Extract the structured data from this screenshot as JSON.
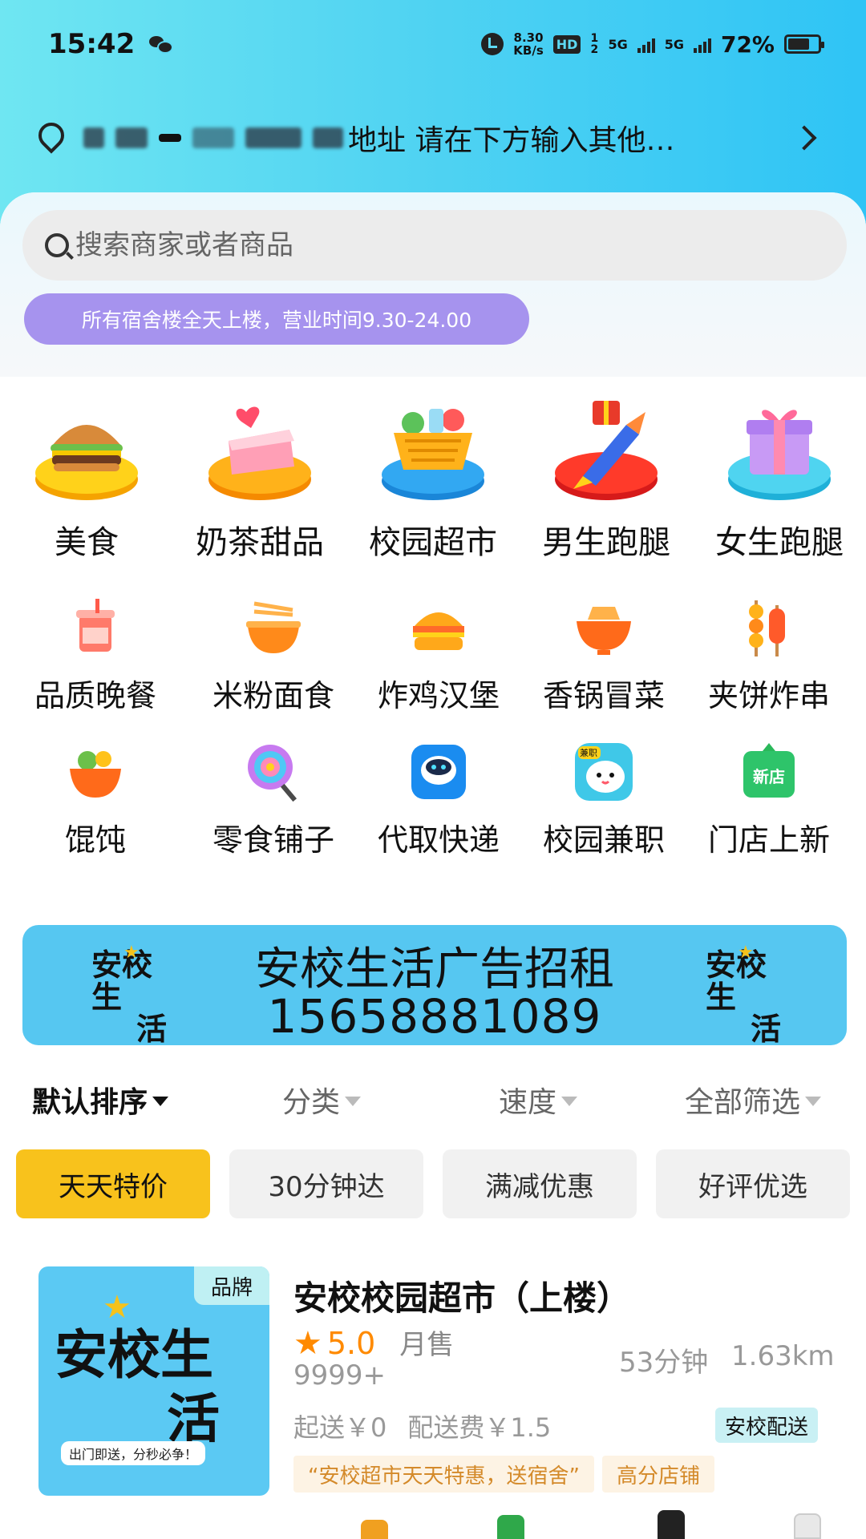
{
  "status_bar": {
    "time": "15:42",
    "speed_top": "8.30",
    "speed_bottom": "KB/s",
    "hd": "HD",
    "hd_sub": "1 2",
    "net1": "5G",
    "net2": "5G",
    "battery": "72%"
  },
  "address": {
    "text": "地址 请在下方输入其他…"
  },
  "search": {
    "placeholder": "搜索商家或者商品"
  },
  "notice": "所有宿舍楼全天上楼，营业时间9.30-24.00",
  "big_categories": [
    {
      "label": "美食",
      "icon": "burger-icon"
    },
    {
      "label": "奶茶甜品",
      "icon": "cake-icon"
    },
    {
      "label": "校园超市",
      "icon": "basket-icon"
    },
    {
      "label": "男生跑腿",
      "icon": "rocket-icon"
    },
    {
      "label": "女生跑腿",
      "icon": "gift-icon"
    }
  ],
  "small_categories": [
    {
      "label": "品质晚餐",
      "icon": "drink-cup-icon"
    },
    {
      "label": "米粉面食",
      "icon": "noodle-bowl-icon"
    },
    {
      "label": "炸鸡汉堡",
      "icon": "burger-icon"
    },
    {
      "label": "香锅冒菜",
      "icon": "hotpot-icon"
    },
    {
      "label": "夹饼炸串",
      "icon": "skewer-icon"
    },
    {
      "label": "馄饨",
      "icon": "salad-bowl-icon"
    },
    {
      "label": "零食铺子",
      "icon": "lollipop-icon"
    },
    {
      "label": "代取快递",
      "icon": "robot-icon"
    },
    {
      "label": "校园兼职",
      "icon": "mascot-icon",
      "badge": "兼职"
    },
    {
      "label": "门店上新",
      "icon": "new-store-icon",
      "badge": "新店"
    }
  ],
  "ad": {
    "title": "安校生活广告招租",
    "phone": "15658881089",
    "logo_text_1": "安校生",
    "logo_text_2": "活"
  },
  "sort": [
    {
      "label": "默认排序",
      "active": true
    },
    {
      "label": "分类",
      "active": false
    },
    {
      "label": "速度",
      "active": false
    },
    {
      "label": "全部筛选",
      "active": false
    }
  ],
  "chips": [
    {
      "label": "天天特价",
      "active": true
    },
    {
      "label": "30分钟达",
      "active": false
    },
    {
      "label": "满减优惠",
      "active": false
    },
    {
      "label": "好评优选",
      "active": false
    }
  ],
  "store": {
    "badge": "品牌",
    "thumb_text_1": "安校生",
    "thumb_text_2": "活",
    "thumb_sub": "出门即送，分秒必争！",
    "name": "安校校园超市（上楼）",
    "rating": "5.0",
    "monthly_label": "月售",
    "monthly_count": "9999+",
    "eta": "53分钟",
    "distance": "1.63km",
    "min_order": "起送￥0",
    "delivery_fee": "配送费￥1.5",
    "delivery_tag": "安校配送",
    "promos": [
      "“安校超市天天特惠，送宿舍”",
      "高分店铺"
    ]
  },
  "colors": {
    "header_start": "#6fe6f2",
    "header_end": "#2fc4f5",
    "notice_bg": "#a693ee",
    "ad_bg": "#56c7f1",
    "chip_active": "#f8c21c",
    "rating": "#ff8a00",
    "promo_text": "#d48a2a"
  }
}
